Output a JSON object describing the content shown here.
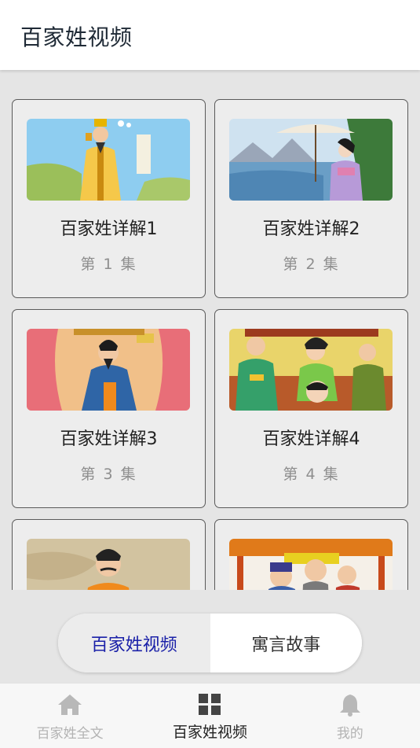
{
  "header": {
    "title": "百家姓视频"
  },
  "cards": [
    {
      "title": "百家姓详解1",
      "episode": "第 1 集"
    },
    {
      "title": "百家姓详解2",
      "episode": "第 2 集"
    },
    {
      "title": "百家姓详解3",
      "episode": "第 3 集"
    },
    {
      "title": "百家姓详解4",
      "episode": "第 4 集"
    }
  ],
  "segment": {
    "active_label": "百家姓视频",
    "other_label": "寓言故事"
  },
  "bottom_nav": [
    {
      "label": "百家姓全文",
      "icon": "home-icon"
    },
    {
      "label": "百家姓视频",
      "icon": "grid-icon"
    },
    {
      "label": "我的",
      "icon": "bell-icon"
    }
  ],
  "colors": {
    "active_segment_text": "#1a20a8",
    "header_bg": "#ffffff",
    "page_bg": "#e5e5e5"
  }
}
